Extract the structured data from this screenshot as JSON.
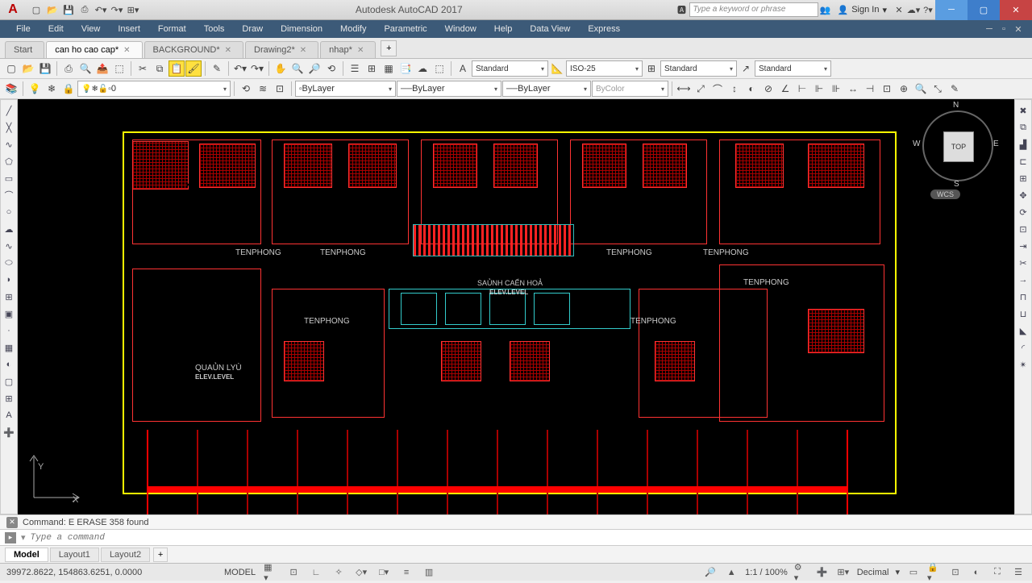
{
  "title": {
    "app": "Autodesk AutoCAD 2017"
  },
  "search": {
    "placeholder": "Type a keyword or phrase"
  },
  "signin": {
    "label": "Sign In"
  },
  "menu": [
    "File",
    "Edit",
    "View",
    "Insert",
    "Format",
    "Tools",
    "Draw",
    "Dimension",
    "Modify",
    "Parametric",
    "Window",
    "Help",
    "Data View",
    "Express"
  ],
  "tabs": [
    {
      "label": "Start",
      "active": false,
      "closable": false
    },
    {
      "label": "can ho cao cap*",
      "active": true,
      "closable": true
    },
    {
      "label": "BACKGROUND*",
      "active": false,
      "closable": true
    },
    {
      "label": "Drawing2*",
      "active": false,
      "closable": true
    },
    {
      "label": "nhap*",
      "active": false,
      "closable": true
    }
  ],
  "props": {
    "textstyle": "Standard",
    "dimstyle": "ISO-25",
    "tablestyle": "Standard",
    "mlstyle": "Standard",
    "layer": "0",
    "bylayer1": "ByLayer",
    "bylayer2": "ByLayer",
    "bylayer3": "ByLayer",
    "bycolor": "ByColor"
  },
  "labels": {
    "tenphong": "TENPHONG",
    "sanh": "SAỦNH CAỂN HOẢ",
    "elev": "ELEV.LEVEL",
    "quanly": "QUAỦN LYÙ"
  },
  "viewcube": {
    "face": "TOP",
    "wcs": "WCS",
    "n": "N",
    "s": "S",
    "e": "E",
    "w": "W"
  },
  "ucs": {
    "x": "X",
    "y": "Y"
  },
  "cmd": {
    "history": "Command: E ERASE 358 found",
    "placeholder": "Type a command"
  },
  "btabs": [
    "Model",
    "Layout1",
    "Layout2"
  ],
  "status": {
    "coords": "39972.8622, 154863.6251, 0.0000",
    "space": "MODEL",
    "scale": "1:1 / 100%",
    "units": "Decimal"
  }
}
